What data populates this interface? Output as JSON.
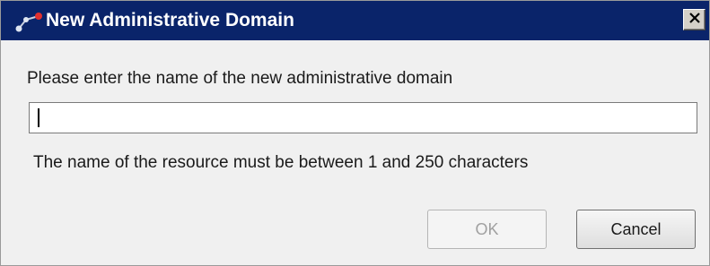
{
  "dialog": {
    "title": "New Administrative Domain",
    "title_icon": "network-nodes-icon",
    "close_label": "✕",
    "close_icon": "close-icon",
    "prompt": "Please enter the name of the new administrative domain",
    "name_input": {
      "value": "",
      "placeholder": ""
    },
    "hint": "The name of the resource must be between 1 and 250 characters",
    "ok_label": "OK",
    "ok_enabled": false,
    "cancel_label": "Cancel"
  },
  "colors": {
    "titlebar": "#0a246a",
    "dialog_bg": "#f0f0f0",
    "icon_accent": "#e0302f"
  }
}
